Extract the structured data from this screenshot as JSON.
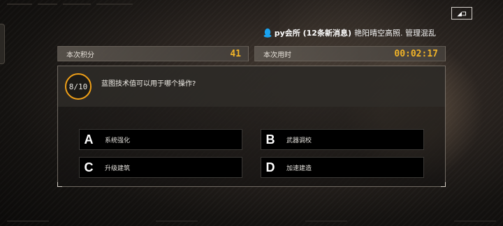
{
  "chat": {
    "group": "py会所 (12条新消息)",
    "message": "艳阳晴空高照. 管理混乱"
  },
  "stats": {
    "score_label": "本次积分",
    "score_value": "41",
    "time_label": "本次用时",
    "time_value": "00:02:17"
  },
  "question": {
    "progress": "8/10",
    "text": "蓝图技术值可以用于哪个操作?"
  },
  "options": [
    {
      "letter": "A",
      "text": "系统强化"
    },
    {
      "letter": "B",
      "text": "武器调校"
    },
    {
      "letter": "C",
      "text": "升级建筑"
    },
    {
      "letter": "D",
      "text": "加速建造"
    }
  ],
  "icons": {
    "back": "back-return-icon",
    "chat": "qq-penguin-icon"
  },
  "colors": {
    "accent": "#f0b328",
    "progress_ring": "#f0a018",
    "qq_blue": "#1aa3f0"
  }
}
